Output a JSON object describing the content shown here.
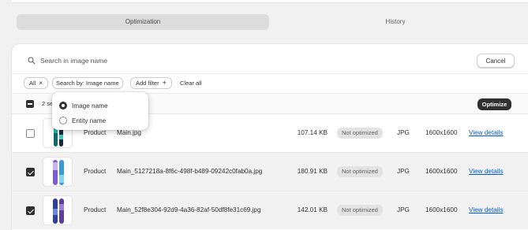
{
  "tabs": [
    {
      "label": "Optimization",
      "active": true
    },
    {
      "label": "History",
      "active": false
    }
  ],
  "search": {
    "placeholder": "Search in image name",
    "value": "",
    "cancel_label": "Cancel"
  },
  "filters": {
    "all_label": "All",
    "search_by_label": "Search by: Image name",
    "add_filter_label": "Add filter",
    "clear_all_label": "Clear all"
  },
  "bulk": {
    "selected_count_label": "2 se",
    "optimize_label": "Optimize"
  },
  "dropdown": {
    "options": [
      {
        "label": "Image name",
        "selected": true
      },
      {
        "label": "Entity name",
        "selected": false
      }
    ]
  },
  "rows": [
    {
      "checked": false,
      "entity": "Product",
      "filename": "Main.jpg",
      "size": "107.14 KB",
      "status": "Not optimized",
      "type": "JPG",
      "dimensions": "1600x1600",
      "action": "View details"
    },
    {
      "checked": true,
      "entity": "Product",
      "filename": "Main_5127218a-8f6c-498f-b489-09242c0fab0a.jpg",
      "size": "180.91 KB",
      "status": "Not optimized",
      "type": "JPG",
      "dimensions": "1600x1600",
      "action": "View details"
    },
    {
      "checked": true,
      "entity": "Product",
      "filename": "Main_52f8e304-92d9-4a36-82af-50df8fe31c69.jpg",
      "size": "142.01 KB",
      "status": "Not optimized",
      "type": "JPG",
      "dimensions": "1600x1600",
      "action": "View details"
    }
  ],
  "icons": {
    "search": "search-icon",
    "close": "close-icon",
    "plus": "plus-icon"
  },
  "colors": {
    "primary_button": "#303030",
    "link": "#005bd3",
    "badge_bg": "#e3e3e3"
  }
}
